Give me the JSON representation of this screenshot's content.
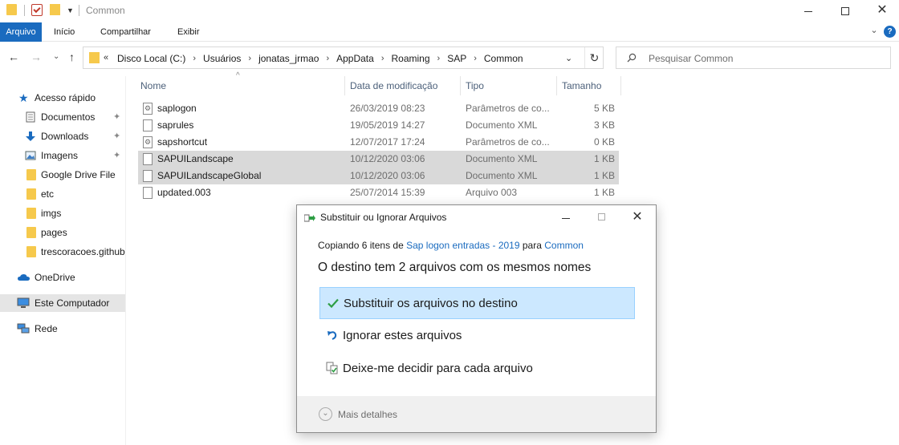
{
  "window": {
    "title": "Common",
    "controls": {
      "minimize": "minimize-icon",
      "maximize": "maximize-icon",
      "close": "✕"
    }
  },
  "ribbon": {
    "tabs": [
      "Arquivo",
      "Início",
      "Compartilhar",
      "Exibir"
    ],
    "expand_glyph": "⌄",
    "help_glyph": "?"
  },
  "navigation": {
    "back": "←",
    "forward": "→",
    "history": "⌄",
    "up": "↑",
    "overflow": "«",
    "breadcrumb": [
      "Disco Local (C:)",
      "Usuários",
      "jonatas_jrmao",
      "AppData",
      "Roaming",
      "SAP",
      "Common"
    ],
    "crumb_separator": "›",
    "address_dropdown": "⌄",
    "refresh": "↻"
  },
  "search": {
    "placeholder": "Pesquisar Common"
  },
  "sidebar": {
    "items": [
      {
        "label": "Acesso rápido",
        "icon": "star-icon",
        "pinned": false
      },
      {
        "label": "Documentos",
        "icon": "documents-icon",
        "pinned": true
      },
      {
        "label": "Downloads",
        "icon": "download-icon",
        "pinned": true
      },
      {
        "label": "Imagens",
        "icon": "pictures-icon",
        "pinned": true
      },
      {
        "label": "Google Drive File",
        "icon": "folder-icon",
        "pinned": false
      },
      {
        "label": "etc",
        "icon": "folder-icon",
        "pinned": false
      },
      {
        "label": "imgs",
        "icon": "folder-icon",
        "pinned": false
      },
      {
        "label": "pages",
        "icon": "folder-icon",
        "pinned": false
      },
      {
        "label": "trescoracoes.github",
        "icon": "folder-icon",
        "pinned": false
      },
      {
        "label": "OneDrive",
        "icon": "cloud-icon",
        "pinned": false
      },
      {
        "label": "Este Computador",
        "icon": "computer-icon",
        "pinned": false,
        "selected": true
      },
      {
        "label": "Rede",
        "icon": "network-icon",
        "pinned": false
      }
    ],
    "pin_glyph": "📌"
  },
  "file_list": {
    "columns": [
      "Nome",
      "Data de modificação",
      "Tipo",
      "Tamanho"
    ],
    "sort_indicator": "^",
    "rows": [
      {
        "name": "saplogon",
        "date": "26/03/2019 08:23",
        "type": "Parâmetros de co...",
        "size": "5 KB",
        "icon": "config-file-icon",
        "highlighted": false
      },
      {
        "name": "saprules",
        "date": "19/05/2019 14:27",
        "type": "Documento XML",
        "size": "3 KB",
        "icon": "file-icon",
        "highlighted": false
      },
      {
        "name": "sapshortcut",
        "date": "12/07/2017 17:24",
        "type": "Parâmetros de co...",
        "size": "0 KB",
        "icon": "config-file-icon",
        "highlighted": false
      },
      {
        "name": "SAPUILandscape",
        "date": "10/12/2020 03:06",
        "type": "Documento XML",
        "size": "1 KB",
        "icon": "file-icon",
        "highlighted": true
      },
      {
        "name": "SAPUILandscapeGlobal",
        "date": "10/12/2020 03:06",
        "type": "Documento XML",
        "size": "1 KB",
        "icon": "file-icon",
        "highlighted": true
      },
      {
        "name": "updated.003",
        "date": "25/07/2014 15:39",
        "type": "Arquivo 003",
        "size": "1 KB",
        "icon": "file-icon",
        "highlighted": false
      }
    ]
  },
  "dialog": {
    "title": "Substituir ou Ignorar Arquivos",
    "copy_prefix": "Copiando 6 itens de ",
    "source": "Sap logon entradas - 2019",
    "copy_middle": " para ",
    "destination": "Common",
    "heading": "O destino tem 2 arquivos com os mesmos nomes",
    "options": [
      {
        "label": "Substituir os arquivos no destino",
        "icon": "checkmark-icon",
        "selected": true
      },
      {
        "label": "Ignorar estes arquivos",
        "icon": "skip-arrow-icon",
        "selected": false
      },
      {
        "label": "Deixe-me decidir para cada arquivo",
        "icon": "compare-files-icon",
        "selected": false
      }
    ],
    "more_details": "Mais detalhes",
    "close_glyph": "✕",
    "accent_color": "#1a6bbf",
    "selected_bg": "#cce8ff"
  }
}
